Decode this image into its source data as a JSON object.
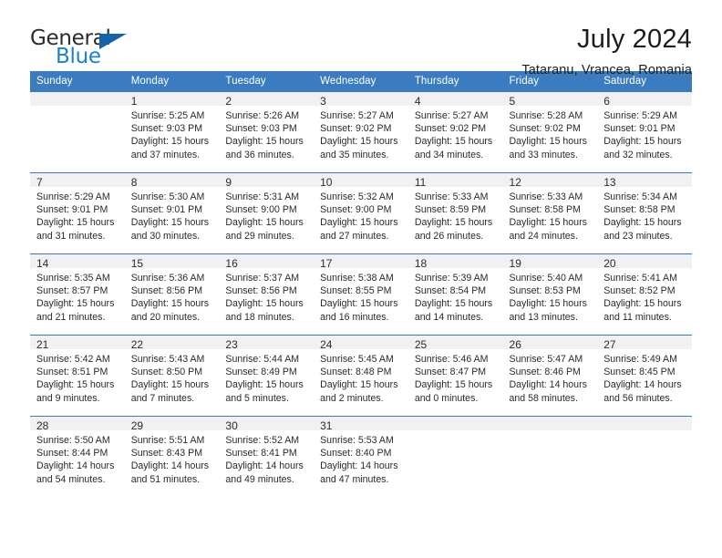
{
  "brand": {
    "name_part1": "General",
    "name_part2": "Blue",
    "colors": {
      "general_text": "#2b2b2b",
      "blue_text": "#1a7fd4",
      "triangle": "#1463ad",
      "header_bar": "#3b7cc0",
      "daynum_band": "#f1f1f1"
    }
  },
  "header": {
    "title": "July 2024",
    "subtitle": "Tataranu, Vrancea, Romania"
  },
  "weekday_headers": [
    "Sunday",
    "Monday",
    "Tuesday",
    "Wednesday",
    "Thursday",
    "Friday",
    "Saturday"
  ],
  "labels": {
    "sunrise_prefix": "Sunrise:",
    "sunset_prefix": "Sunset:",
    "daylight_prefix": "Daylight:"
  },
  "weeks": [
    [
      {
        "day": "",
        "empty": true,
        "line1": "",
        "line2": "",
        "line3": "",
        "line4": ""
      },
      {
        "day": "1",
        "empty": false,
        "line1": "Sunrise: 5:25 AM",
        "line2": "Sunset: 9:03 PM",
        "line3": "Daylight: 15 hours",
        "line4": "and 37 minutes."
      },
      {
        "day": "2",
        "empty": false,
        "line1": "Sunrise: 5:26 AM",
        "line2": "Sunset: 9:03 PM",
        "line3": "Daylight: 15 hours",
        "line4": "and 36 minutes."
      },
      {
        "day": "3",
        "empty": false,
        "line1": "Sunrise: 5:27 AM",
        "line2": "Sunset: 9:02 PM",
        "line3": "Daylight: 15 hours",
        "line4": "and 35 minutes."
      },
      {
        "day": "4",
        "empty": false,
        "line1": "Sunrise: 5:27 AM",
        "line2": "Sunset: 9:02 PM",
        "line3": "Daylight: 15 hours",
        "line4": "and 34 minutes."
      },
      {
        "day": "5",
        "empty": false,
        "line1": "Sunrise: 5:28 AM",
        "line2": "Sunset: 9:02 PM",
        "line3": "Daylight: 15 hours",
        "line4": "and 33 minutes."
      },
      {
        "day": "6",
        "empty": false,
        "line1": "Sunrise: 5:29 AM",
        "line2": "Sunset: 9:01 PM",
        "line3": "Daylight: 15 hours",
        "line4": "and 32 minutes."
      }
    ],
    [
      {
        "day": "7",
        "empty": false,
        "line1": "Sunrise: 5:29 AM",
        "line2": "Sunset: 9:01 PM",
        "line3": "Daylight: 15 hours",
        "line4": "and 31 minutes."
      },
      {
        "day": "8",
        "empty": false,
        "line1": "Sunrise: 5:30 AM",
        "line2": "Sunset: 9:01 PM",
        "line3": "Daylight: 15 hours",
        "line4": "and 30 minutes."
      },
      {
        "day": "9",
        "empty": false,
        "line1": "Sunrise: 5:31 AM",
        "line2": "Sunset: 9:00 PM",
        "line3": "Daylight: 15 hours",
        "line4": "and 29 minutes."
      },
      {
        "day": "10",
        "empty": false,
        "line1": "Sunrise: 5:32 AM",
        "line2": "Sunset: 9:00 PM",
        "line3": "Daylight: 15 hours",
        "line4": "and 27 minutes."
      },
      {
        "day": "11",
        "empty": false,
        "line1": "Sunrise: 5:33 AM",
        "line2": "Sunset: 8:59 PM",
        "line3": "Daylight: 15 hours",
        "line4": "and 26 minutes."
      },
      {
        "day": "12",
        "empty": false,
        "line1": "Sunrise: 5:33 AM",
        "line2": "Sunset: 8:58 PM",
        "line3": "Daylight: 15 hours",
        "line4": "and 24 minutes."
      },
      {
        "day": "13",
        "empty": false,
        "line1": "Sunrise: 5:34 AM",
        "line2": "Sunset: 8:58 PM",
        "line3": "Daylight: 15 hours",
        "line4": "and 23 minutes."
      }
    ],
    [
      {
        "day": "14",
        "empty": false,
        "line1": "Sunrise: 5:35 AM",
        "line2": "Sunset: 8:57 PM",
        "line3": "Daylight: 15 hours",
        "line4": "and 21 minutes."
      },
      {
        "day": "15",
        "empty": false,
        "line1": "Sunrise: 5:36 AM",
        "line2": "Sunset: 8:56 PM",
        "line3": "Daylight: 15 hours",
        "line4": "and 20 minutes."
      },
      {
        "day": "16",
        "empty": false,
        "line1": "Sunrise: 5:37 AM",
        "line2": "Sunset: 8:56 PM",
        "line3": "Daylight: 15 hours",
        "line4": "and 18 minutes."
      },
      {
        "day": "17",
        "empty": false,
        "line1": "Sunrise: 5:38 AM",
        "line2": "Sunset: 8:55 PM",
        "line3": "Daylight: 15 hours",
        "line4": "and 16 minutes."
      },
      {
        "day": "18",
        "empty": false,
        "line1": "Sunrise: 5:39 AM",
        "line2": "Sunset: 8:54 PM",
        "line3": "Daylight: 15 hours",
        "line4": "and 14 minutes."
      },
      {
        "day": "19",
        "empty": false,
        "line1": "Sunrise: 5:40 AM",
        "line2": "Sunset: 8:53 PM",
        "line3": "Daylight: 15 hours",
        "line4": "and 13 minutes."
      },
      {
        "day": "20",
        "empty": false,
        "line1": "Sunrise: 5:41 AM",
        "line2": "Sunset: 8:52 PM",
        "line3": "Daylight: 15 hours",
        "line4": "and 11 minutes."
      }
    ],
    [
      {
        "day": "21",
        "empty": false,
        "line1": "Sunrise: 5:42 AM",
        "line2": "Sunset: 8:51 PM",
        "line3": "Daylight: 15 hours",
        "line4": "and 9 minutes."
      },
      {
        "day": "22",
        "empty": false,
        "line1": "Sunrise: 5:43 AM",
        "line2": "Sunset: 8:50 PM",
        "line3": "Daylight: 15 hours",
        "line4": "and 7 minutes."
      },
      {
        "day": "23",
        "empty": false,
        "line1": "Sunrise: 5:44 AM",
        "line2": "Sunset: 8:49 PM",
        "line3": "Daylight: 15 hours",
        "line4": "and 5 minutes."
      },
      {
        "day": "24",
        "empty": false,
        "line1": "Sunrise: 5:45 AM",
        "line2": "Sunset: 8:48 PM",
        "line3": "Daylight: 15 hours",
        "line4": "and 2 minutes."
      },
      {
        "day": "25",
        "empty": false,
        "line1": "Sunrise: 5:46 AM",
        "line2": "Sunset: 8:47 PM",
        "line3": "Daylight: 15 hours",
        "line4": "and 0 minutes."
      },
      {
        "day": "26",
        "empty": false,
        "line1": "Sunrise: 5:47 AM",
        "line2": "Sunset: 8:46 PM",
        "line3": "Daylight: 14 hours",
        "line4": "and 58 minutes."
      },
      {
        "day": "27",
        "empty": false,
        "line1": "Sunrise: 5:49 AM",
        "line2": "Sunset: 8:45 PM",
        "line3": "Daylight: 14 hours",
        "line4": "and 56 minutes."
      }
    ],
    [
      {
        "day": "28",
        "empty": false,
        "line1": "Sunrise: 5:50 AM",
        "line2": "Sunset: 8:44 PM",
        "line3": "Daylight: 14 hours",
        "line4": "and 54 minutes."
      },
      {
        "day": "29",
        "empty": false,
        "line1": "Sunrise: 5:51 AM",
        "line2": "Sunset: 8:43 PM",
        "line3": "Daylight: 14 hours",
        "line4": "and 51 minutes."
      },
      {
        "day": "30",
        "empty": false,
        "line1": "Sunrise: 5:52 AM",
        "line2": "Sunset: 8:41 PM",
        "line3": "Daylight: 14 hours",
        "line4": "and 49 minutes."
      },
      {
        "day": "31",
        "empty": false,
        "line1": "Sunrise: 5:53 AM",
        "line2": "Sunset: 8:40 PM",
        "line3": "Daylight: 14 hours",
        "line4": "and 47 minutes."
      },
      {
        "day": "",
        "empty": true,
        "line1": "",
        "line2": "",
        "line3": "",
        "line4": ""
      },
      {
        "day": "",
        "empty": true,
        "line1": "",
        "line2": "",
        "line3": "",
        "line4": ""
      },
      {
        "day": "",
        "empty": true,
        "line1": "",
        "line2": "",
        "line3": "",
        "line4": ""
      }
    ]
  ]
}
